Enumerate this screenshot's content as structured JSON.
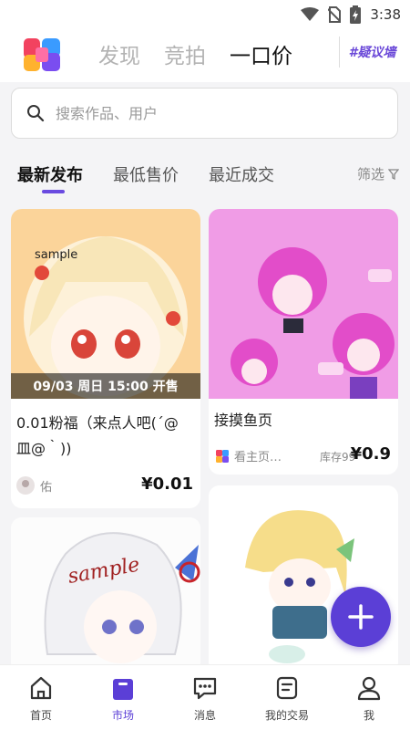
{
  "status_bar": {
    "time": "3:38"
  },
  "header": {
    "tabs": [
      {
        "label": "发现"
      },
      {
        "label": "竞拍"
      },
      {
        "label": "一口价"
      }
    ],
    "badge": "#疑议墙"
  },
  "search": {
    "placeholder": "搜索作品、用户"
  },
  "sort": {
    "tabs": [
      {
        "label": "最新发布"
      },
      {
        "label": "最低售价"
      },
      {
        "label": "最近成交"
      }
    ],
    "filter_label": "筛选"
  },
  "cards": [
    {
      "time_banner": "09/03 周日 15:00 开售",
      "title_line1": "0.01粉福（来点人吧(´@",
      "title_line2": "皿@｀))",
      "seller": "佑",
      "price": "¥0.01",
      "image_text": "sample"
    },
    {
      "title": "接摸鱼页",
      "seller": "看主页…",
      "stock": "库存99",
      "price": "¥0.9"
    },
    {
      "image_text": "sample"
    },
    {}
  ],
  "bottom_nav": [
    {
      "label": "首页"
    },
    {
      "label": "市场"
    },
    {
      "label": "消息"
    },
    {
      "label": "我的交易"
    },
    {
      "label": "我"
    }
  ],
  "colors": {
    "accent": "#5b3fd6",
    "underline": "#6a4be0"
  }
}
